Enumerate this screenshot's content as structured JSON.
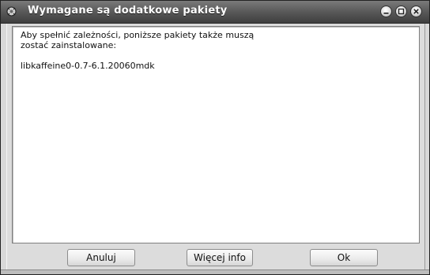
{
  "window": {
    "title": "Wymagane są dodatkowe pakiety"
  },
  "message": {
    "text": "Aby spełnić zależności, poniższe pakiety także muszą\nzostać zainstalowane:",
    "package": "libkaffeine0-0.7-6.1.20060mdk"
  },
  "buttons": {
    "cancel": "Anuluj",
    "more_info": "Więcej info",
    "ok": "Ok"
  },
  "icons": {
    "app": "app-icon",
    "minimize": "minimize-icon",
    "maximize": "maximize-icon",
    "close": "close-icon"
  }
}
